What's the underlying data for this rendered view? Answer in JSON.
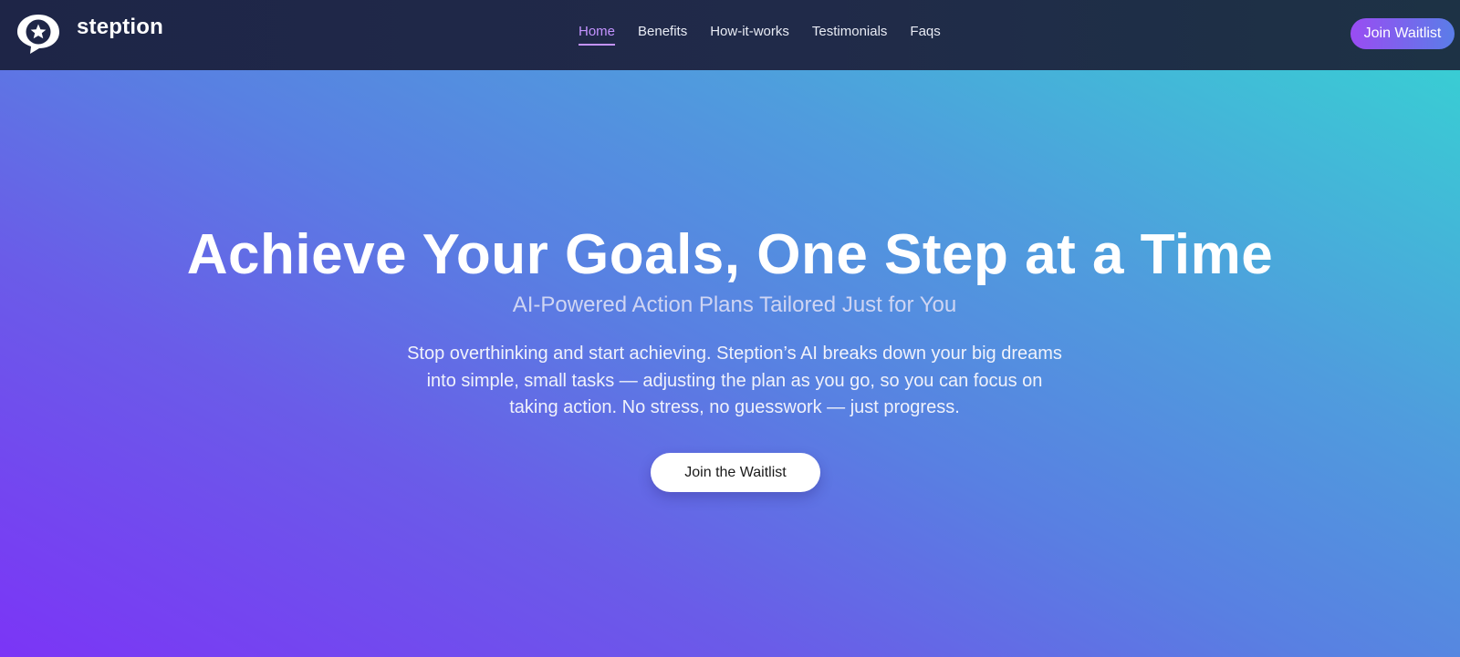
{
  "brand": {
    "name": "steption",
    "logo_icon": "star-speech-bubble-icon"
  },
  "nav": {
    "links": [
      {
        "label": "Home",
        "active": true
      },
      {
        "label": "Benefits",
        "active": false
      },
      {
        "label": "How-it-works",
        "active": false
      },
      {
        "label": "Testimonials",
        "active": false
      },
      {
        "label": "Faqs",
        "active": false
      }
    ],
    "cta_label": "Join Waitlist"
  },
  "hero": {
    "title": "Achieve Your Goals, One Step at a Time",
    "subtitle": "AI-Powered Action Plans Tailored Just for You",
    "description": "Stop overthinking and start achieving. Steption’s AI breaks down your big dreams into simple, small tasks — adjusting the plan as you go, so you can focus on taking action. No stress, no guesswork — just progress.",
    "cta_label": "Join the Waitlist"
  },
  "colors": {
    "nav_background": "#1e2547",
    "active_link": "#c493ff",
    "hero_gradient_start": "#7b35f6",
    "hero_gradient_end": "#39cdd4",
    "cta_gradient_start": "#9a4cf2",
    "cta_gradient_end": "#5a7de8"
  }
}
